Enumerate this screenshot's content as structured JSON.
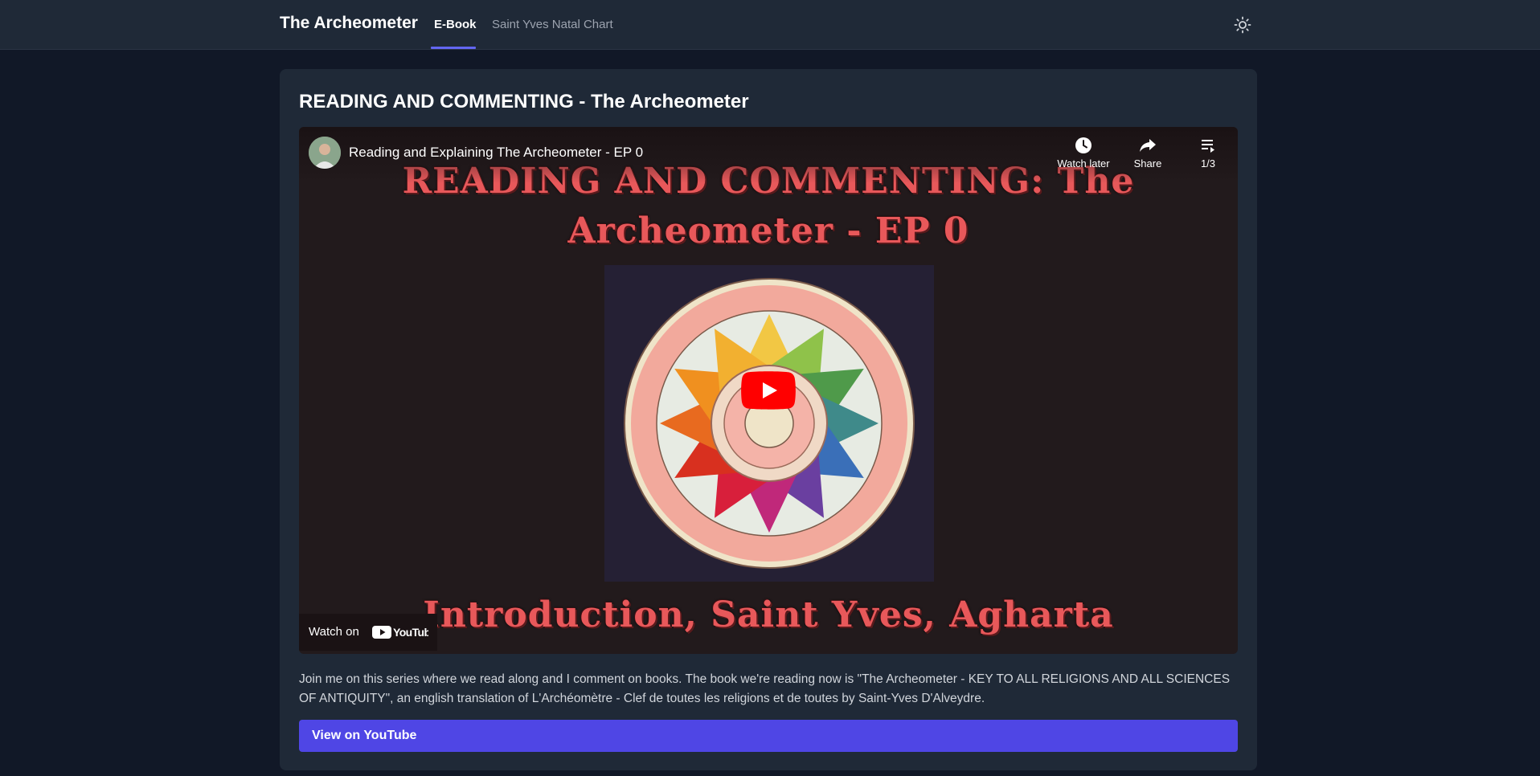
{
  "header": {
    "brand": "The Archeometer",
    "tabs": [
      {
        "label": "E-Book",
        "active": true
      },
      {
        "label": "Saint Yves Natal Chart",
        "active": false
      }
    ],
    "theme_icon": "sun-icon"
  },
  "main": {
    "title": "READING AND COMMENTING - The Archeometer",
    "video": {
      "title": "Reading and Explaining The Archeometer - EP 0",
      "controls": {
        "watch_later": "Watch later",
        "share": "Share",
        "playlist_position": "1/3"
      },
      "thumbnail": {
        "line1": "READING AND COMMENTING: The",
        "line2": "Archeometer - EP 0",
        "line3": "Introduction, Saint Yves, Agharta"
      },
      "watch_on": "Watch on",
      "platform": "YouTube"
    },
    "description": "Join me on this series where we read along and I comment on books. The book we're reading now is \"The Archeometer - KEY TO ALL RELIGIONS AND ALL SCIENCES OF ANTIQUITY\", an english translation of L'Archéomètre - Clef de toutes les religions et de toutes by Saint-Yves D'Alveydre.",
    "button_label": "View on YouTube"
  },
  "colors": {
    "background": "#111827",
    "card": "#1f2937",
    "accent": "#4f46e5",
    "thumbnail_text": "#e8585a",
    "youtube_red": "#ff0000"
  }
}
